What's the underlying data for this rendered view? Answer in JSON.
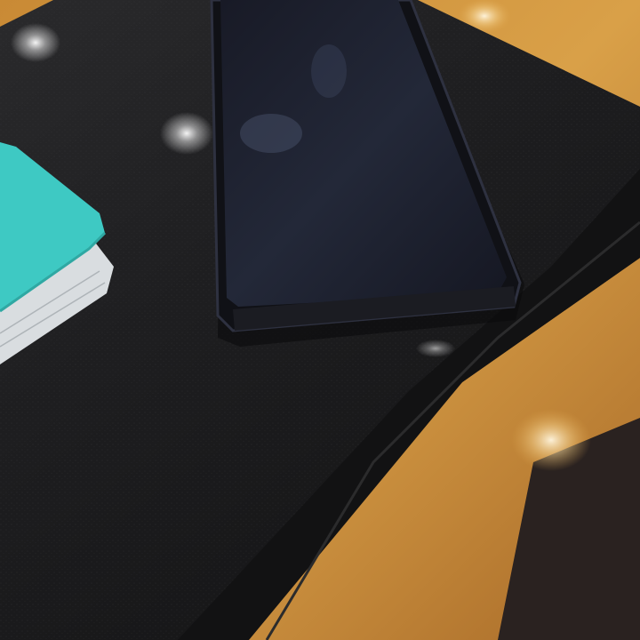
{
  "scene": {
    "subjects": [
      "smartphone",
      "laptop-case",
      "notebook",
      "wooden-table"
    ],
    "colors": {
      "table_wood": "#d79a3c",
      "table_wood_dark": "#8a5a22",
      "case_black": "#1c1c1e",
      "case_edge": "#0f0f10",
      "phone_body": "#15161c",
      "phone_screen": "#1e2130",
      "notebook_cover": "#3ec9c3",
      "notebook_pages": "#d9dde0"
    }
  }
}
